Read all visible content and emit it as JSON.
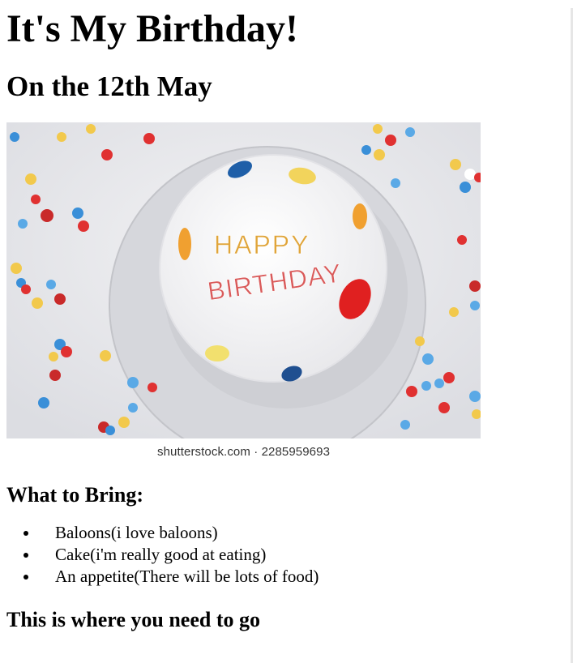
{
  "page": {
    "title": "It's My Birthday!",
    "subtitle": "On the 12th May"
  },
  "hero_image": {
    "icon": "birthday-cake-photo",
    "cake_text_line1": "HAPPY",
    "cake_text_line2": "BIRTHDAY",
    "watermark": "shutterstock.com · 2285959693"
  },
  "bring_section": {
    "heading": "What to Bring:",
    "items": [
      "Baloons(i love baloons)",
      "Cake(i'm really good at eating)",
      "An appetite(There will be lots of food)"
    ]
  },
  "directions": {
    "heading": "This is where you need to go"
  },
  "colors": {
    "background": "#ffffff",
    "text": "#000000"
  }
}
